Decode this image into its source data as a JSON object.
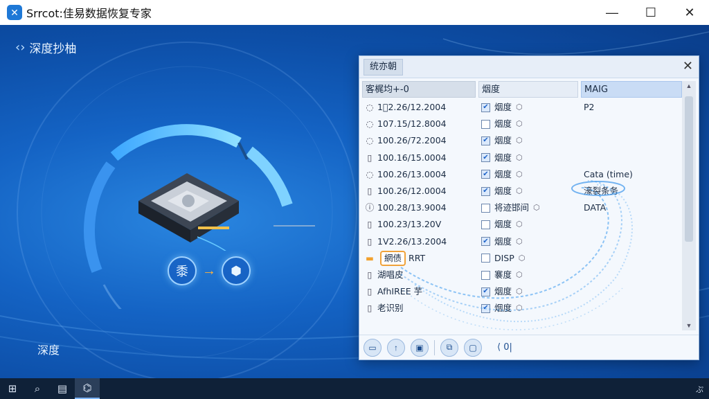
{
  "window": {
    "title": "Srrcot:佳易数据恢复专家",
    "logo_icon": "app-logo-icon",
    "logo_glyph": "✕",
    "controls": {
      "minimize": "—",
      "maximize": "☐",
      "close": "✕"
    }
  },
  "main": {
    "section_title": "深度抄柚",
    "section_icon": "scan-icon",
    "section_icon_glyph": "‹›",
    "bottom_label": "深度",
    "steps": [
      {
        "icon": "drive-step-icon",
        "glyph": "黍"
      },
      {
        "icon": "cube-step-icon",
        "glyph": "⬢"
      }
    ],
    "step_arrow": "→"
  },
  "dialog": {
    "tab_label": "统亦朝",
    "close": "✕",
    "columns": [
      "客梶均+-0",
      "烟度",
      "MAIG"
    ],
    "rows": [
      {
        "icon": "clock-icon",
        "glyph": "◌",
        "name": "1\u00002.26/12.2004",
        "checked": true,
        "status": "烟度",
        "info": "P2"
      },
      {
        "icon": "clock-icon",
        "glyph": "◌",
        "name": "107.15/12.8004",
        "checked": false,
        "status": "烟度",
        "info": ""
      },
      {
        "icon": "clock-icon",
        "glyph": "◌",
        "name": "100.26/72.2004",
        "checked": true,
        "status": "烟度",
        "info": ""
      },
      {
        "icon": "file-icon",
        "glyph": "▯",
        "name": "100.16/15.0004",
        "checked": true,
        "status": "烟度",
        "info": ""
      },
      {
        "icon": "clock-icon",
        "glyph": "◌",
        "name": "100.26/13.0004",
        "checked": true,
        "status": "烟度",
        "info": "Cata (time)"
      },
      {
        "icon": "file-icon",
        "glyph": "▯",
        "name": "100.26/12.0004",
        "checked": true,
        "status": "烟度",
        "info": "濠裂条务"
      },
      {
        "icon": "info-icon",
        "glyph": "ⓘ",
        "name": "100.28/13.9004",
        "checked": false,
        "status": "将迹邯间",
        "info": "DATA"
      },
      {
        "icon": "file-icon",
        "glyph": "▯",
        "name": "100.23/13.20V",
        "checked": false,
        "status": "烟度",
        "info": ""
      },
      {
        "icon": "file-icon",
        "glyph": "▯",
        "name": "1V2.26/13.2004",
        "checked": true,
        "status": "烟度",
        "info": ""
      },
      {
        "icon": "folder-icon",
        "glyph": "▬",
        "name": "網债",
        "suffix": "RRT",
        "checked": false,
        "status": "DISP",
        "info": "",
        "folder": true
      },
      {
        "icon": "file-icon",
        "glyph": "▯",
        "name": "湖唱皮",
        "checked": false,
        "status": "褰度",
        "info": ""
      },
      {
        "icon": "file-icon",
        "glyph": "▯",
        "name": "AfhIREE 芋",
        "checked": true,
        "status": "烟度",
        "info": ""
      },
      {
        "icon": "file-icon",
        "glyph": "▯",
        "name": "老识别",
        "checked": true,
        "status": "烟度",
        "info": ""
      }
    ],
    "toolbar": {
      "buttons": [
        {
          "name": "open-folder-icon",
          "glyph": "▭"
        },
        {
          "name": "upload-icon",
          "glyph": "↑"
        },
        {
          "name": "image-icon",
          "glyph": "▣"
        },
        {
          "name": "copy-icon",
          "glyph": "⧉"
        },
        {
          "name": "monitor-icon",
          "glyph": "▢"
        }
      ],
      "extra_label": "⟨ 0|"
    }
  },
  "taskbar": {
    "items": [
      {
        "name": "windows-start-icon",
        "glyph": "⊞"
      },
      {
        "name": "search-icon",
        "glyph": "⌕"
      },
      {
        "name": "file-explorer-icon",
        "glyph": "▤"
      },
      {
        "name": "recovery-app-icon",
        "glyph": "⌬"
      }
    ],
    "tray_text": "ぷ"
  }
}
